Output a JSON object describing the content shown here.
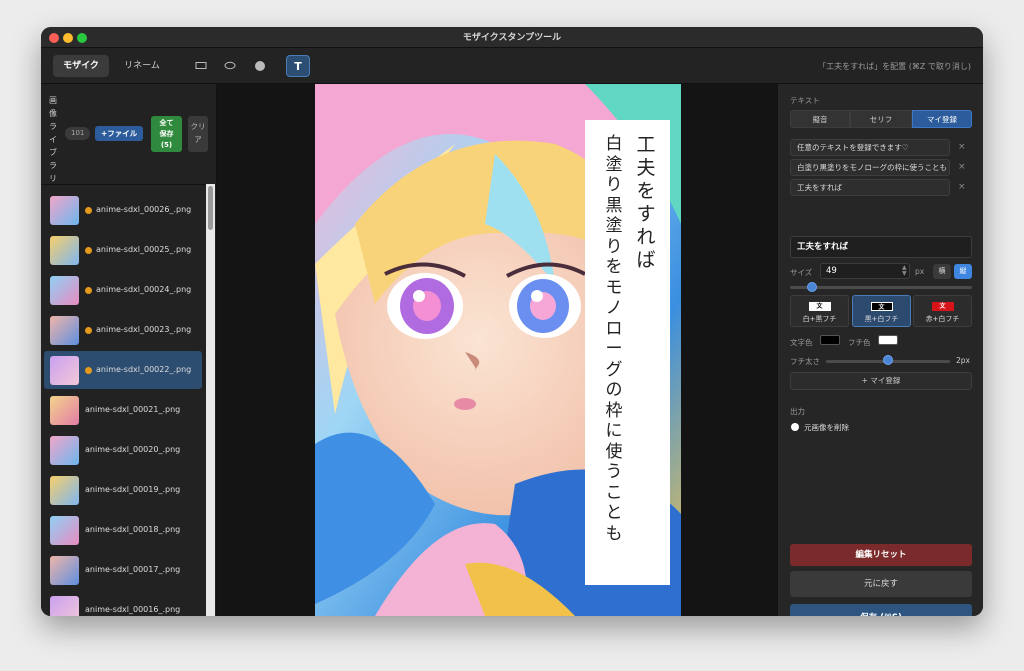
{
  "window": {
    "title": "モザイクスタンプツール"
  },
  "toolbar": {
    "tab_mosaic": "モザイク",
    "tab_rename": "リネーム",
    "tool_text": "T",
    "hint": "「工夫をすれば」を配置 (⌘Z で取り消し)"
  },
  "library": {
    "title": "画像ライブラリ",
    "count": "101",
    "add_file": "+ファイル",
    "save_all_line1": "全て",
    "save_all_line2": "保存",
    "save_all_line3": "(5)",
    "clear": "クリア",
    "files": [
      {
        "name": "anime-sdxl_00026_.png",
        "modified": true
      },
      {
        "name": "anime-sdxl_00025_.png",
        "modified": true
      },
      {
        "name": "anime-sdxl_00024_.png",
        "modified": true
      },
      {
        "name": "anime-sdxl_00023_.png",
        "modified": true
      },
      {
        "name": "anime-sdxl_00022_.png",
        "modified": true
      },
      {
        "name": "anime-sdxl_00021_.png",
        "modified": false
      },
      {
        "name": "anime-sdxl_00020_.png",
        "modified": false
      },
      {
        "name": "anime-sdxl_00019_.png",
        "modified": false
      },
      {
        "name": "anime-sdxl_00018_.png",
        "modified": false
      },
      {
        "name": "anime-sdxl_00017_.png",
        "modified": false
      },
      {
        "name": "anime-sdxl_00016_.png",
        "modified": false
      }
    ]
  },
  "canvas": {
    "overlay_col1": "工夫をすれば",
    "overlay_col2": "白塗り黒塗りをモノローグの枠に使うことも"
  },
  "panel": {
    "text_section": "テキスト",
    "preset_tabs": [
      "擬音",
      "セリフ",
      "マイ登録"
    ],
    "saved_texts": [
      "任意のテキストを登録できます♡",
      "白塗り黒塗りをモノローグの枠に使うことも",
      "工夫をすれば"
    ],
    "remove_mark": "×",
    "text_value": "工夫をすれば",
    "size_label": "サイズ",
    "size_value": "49",
    "size_unit": "px",
    "orient_h": "横",
    "orient_v": "縦",
    "size_slider_fraction": 0.12,
    "styles": [
      {
        "swatch": "文",
        "label": "白+黒フチ"
      },
      {
        "swatch": "文",
        "label": "黒+白フチ"
      },
      {
        "swatch": "文",
        "label": "赤+白フチ"
      }
    ],
    "text_color_label": "文字色",
    "text_color": "#000000",
    "stroke_color_label": "フチ色",
    "stroke_color": "#ffffff",
    "stroke_width_label": "フチ太さ",
    "stroke_width_value": "2px",
    "stroke_slider_fraction": 0.5,
    "register_button": "+ マイ登録",
    "output_section": "出力",
    "delete_original_label": "元画像を削除",
    "edit_reset": "編集リセット",
    "undo": "元に戻す",
    "save": "保存 (⌘S)"
  },
  "colors": {
    "accent": "#2d5c9c",
    "save_all": "#2f8a3d",
    "reset": "#7a2a2a",
    "modified_dot": "#e69a1c"
  }
}
